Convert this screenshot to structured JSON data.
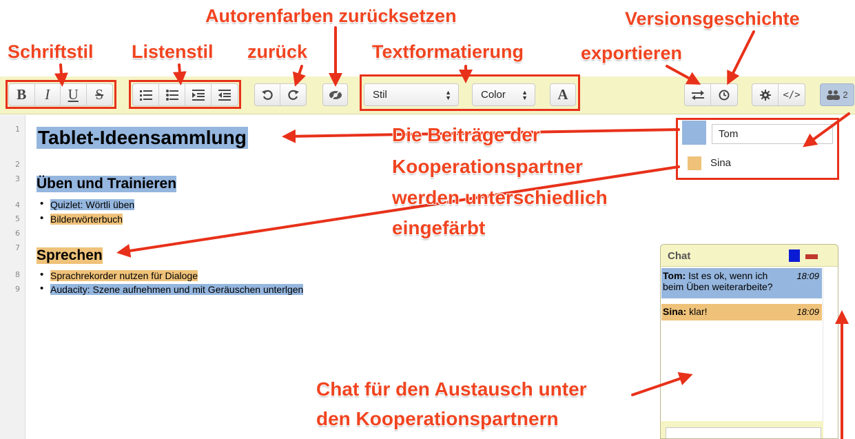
{
  "toolbar": {
    "format": {
      "bold": "B",
      "italic": "I",
      "underline": "U",
      "strike": "S"
    },
    "style_select": "Stil",
    "color_select": "Color",
    "font_button": "A",
    "user_count": "2"
  },
  "editor": {
    "line_numbers": [
      "1",
      "2",
      "3",
      "4",
      "5",
      "6",
      "7",
      "8",
      "9"
    ],
    "title": "Tablet-Ideensammlung",
    "heading1": "Üben und Trainieren",
    "items1": [
      "Quizlet: Wörtli üben",
      "Bilderwörterbuch"
    ],
    "heading2": "Sprechen",
    "items2": [
      "Sprachrekorder nutzen für Dialoge",
      "Audacity: Szene aufnehmen und mit Geräuschen unterlgen"
    ]
  },
  "users": [
    {
      "name": "Tom",
      "color": "#95b6de"
    },
    {
      "name": "Sina",
      "color": "#efc27a"
    }
  ],
  "chat": {
    "title": "Chat",
    "messages": [
      {
        "author": "Tom:",
        "text": " Ist es ok, wenn ich",
        "text2": "beim Üben weiterarbeite?",
        "time": "18:09",
        "color": "#95b6de"
      },
      {
        "author": "Sina:",
        "text": " klar!",
        "time": "18:09",
        "color": "#efc27a"
      }
    ]
  },
  "annotations": {
    "schriftstil": "Schriftstil",
    "listenstil": "Listenstil",
    "zurueck": "zurück",
    "autorenfarben": "Autorenfarben zurücksetzen",
    "textformatierung": "Textformatierung",
    "versionsgeschichte": "Versionsgeschichte",
    "exportieren": "exportieren",
    "beitraege": [
      "Die Beiträge der",
      "Kooperationspartner",
      "werden unterschiedlich",
      "eingefärbt"
    ],
    "chat_info": [
      "Chat für den Austausch unter",
      "den Kooperationspartnern"
    ]
  },
  "colors": {
    "accent": "#e8311a",
    "toolbar_bg": "#f5f4c4",
    "author_tom": "#95b6de",
    "author_sina": "#efc27a"
  }
}
